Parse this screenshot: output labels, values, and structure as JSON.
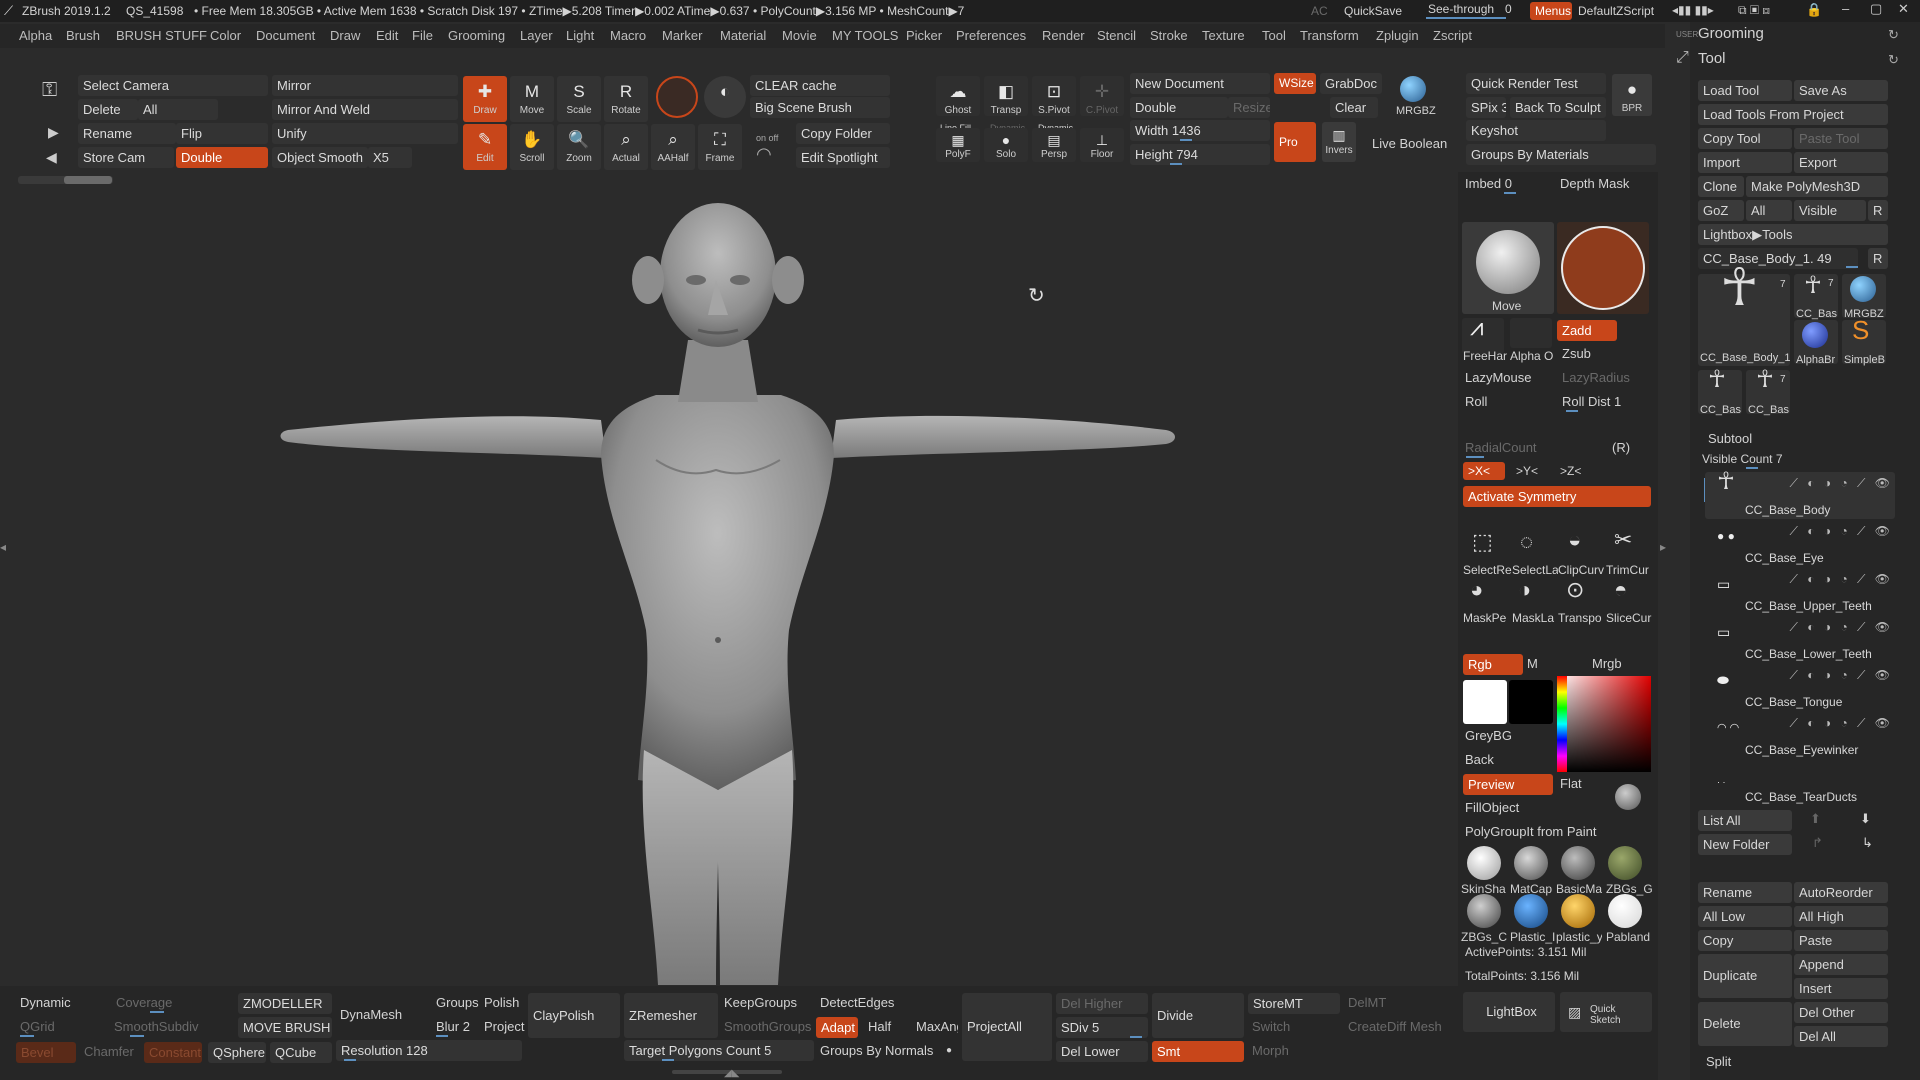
{
  "title_bar": {
    "app": "ZBrush 2019.1.2",
    "id": "QS_41598",
    "stats": "• Free Mem 18.305GB • Active Mem 1638 • Scratch Disk 197 • ZTime▶5.208 Timer▶0.002 ATime▶0.637 • PolyCount▶3.156 MP • MeshCount▶7",
    "ac": "AC",
    "quicksave": "QuickSave",
    "see_through": "See-through",
    "see_through_val": "0",
    "menus": "Menus",
    "script": "DefaultZScript"
  },
  "menu": [
    "Alpha",
    "Brush",
    "BRUSH STUFF",
    "Color",
    "Document",
    "Draw",
    "Edit",
    "File",
    "Grooming",
    "Layer",
    "Light",
    "Macro",
    "Marker",
    "Material",
    "Movie",
    "MY TOOLS",
    "Picker",
    "Preferences",
    "Render",
    "Stencil",
    "Stroke",
    "Texture",
    "Tool",
    "Transform",
    "Zplugin",
    "Zscript"
  ],
  "shelf": {
    "select_camera": "Select Camera",
    "delete": "Delete",
    "all": "All",
    "rename": "Rename",
    "store_cam": "Store Cam",
    "double": "Double",
    "mirror": "Mirror",
    "mirror_weld": "Mirror And Weld",
    "flip": "Flip",
    "unify": "Unify",
    "object_smooth": "Object Smooth",
    "x5": "X5",
    "draw": "Draw",
    "move": "Move",
    "scale": "Scale",
    "rotate": "Rotate",
    "edit": "Edit",
    "scroll": "Scroll",
    "zoom": "Zoom",
    "actual": "Actual",
    "aahalf": "AAHalf",
    "frame": "Frame",
    "clear_cache": "CLEAR cache",
    "big_scene_brush": "Big Scene Brush",
    "copy_folder": "Copy Folder",
    "edit_spotlight": "Edit Spotlight",
    "ghost": "Ghost",
    "transp": "Transp",
    "spivot": "S.Pivot",
    "cpivot": "C.Pivot",
    "polyf": "PolyF",
    "line_fill": "Line Fill",
    "solo": "Solo",
    "dynamic": "Dynamic",
    "persp": "Persp",
    "floor": "Floor",
    "new_document": "New Document",
    "wsize": "WSize",
    "grabdoc": "GrabDoc",
    "doc_double": "Double",
    "resize": "Resize",
    "clear": "Clear",
    "width": "Width 1436",
    "height": "Height 794",
    "pro": "Pro",
    "invers": "Invers",
    "live_boolean": "Live Boolean",
    "mrgbz": "MRGBZ",
    "quick_render": "Quick Render Test",
    "spix": "SPix 3",
    "back_to_sculpt": "Back To Sculpt",
    "bpr": "BPR",
    "keyshot": "Keyshot",
    "groups_by_materials": "Groups By Materials"
  },
  "brush_panel": {
    "imbed": "Imbed 0",
    "depth_mask": "Depth Mask",
    "move": "Move",
    "freehand": "FreeHar",
    "alpha_off": "Alpha O",
    "zadd": "Zadd",
    "zsub": "Zsub",
    "lazymouse": "LazyMouse",
    "lazyradius": "LazyRadius",
    "roll": "Roll",
    "roll_dist": "Roll Dist 1",
    "radialcount": "RadialCount",
    "r": "(R)",
    "sym_x": ">X<",
    "sym_y": ">Y<",
    "sym_z": ">Z<",
    "activate_symmetry": "Activate Symmetry",
    "tools": [
      "SelectRe",
      "SelectLa",
      "ClipCurv",
      "TrimCur",
      "MaskPe",
      "MaskLa",
      "Transpo",
      "SliceCur"
    ],
    "rgb": "Rgb",
    "m": "M",
    "mrgb": "Mrgb",
    "greybg": "GreyBG",
    "back": "Back",
    "preview": "Preview",
    "flat": "Flat",
    "fillobject": "FillObject",
    "polygroupit": "PolyGroupIt from Paint",
    "materials": [
      "SkinSha",
      "MatCap",
      "BasicMa",
      "ZBGs_G",
      "ZBGs_C",
      "Plastic_I",
      "plastic_y",
      "Pabland"
    ],
    "active_points": "ActivePoints: 3.151 Mil",
    "total_points": "TotalPoints: 3.156 Mil",
    "lightbox": "LightBox",
    "quick_sketch": "Quick Sketch"
  },
  "tool_panel": {
    "grooming": "Grooming",
    "tool": "Tool",
    "load_tool": "Load Tool",
    "save_as": "Save As",
    "load_from_project": "Load Tools From Project",
    "copy_tool": "Copy Tool",
    "paste_tool": "Paste Tool",
    "import": "Import",
    "export": "Export",
    "clone": "Clone",
    "make_polymesh": "Make PolyMesh3D",
    "goz": "GoZ",
    "all": "All",
    "visible": "Visible",
    "r": "R",
    "lightbox_tools": "Lightbox▶Tools",
    "current_tool": "CC_Base_Body_1. 49",
    "thumb_labels": [
      "CC_Base_Body_1",
      "CC_Bas",
      "MRGBZ",
      "AlphaBr",
      "SimpleB",
      "CC_Bas",
      "CC_Bas"
    ],
    "thumb_counts": [
      "7",
      "7",
      "7"
    ],
    "subtool": "Subtool",
    "visible_count": "Visible Count 7",
    "subtools": [
      "CC_Base_Body",
      "CC_Base_Eye",
      "CC_Base_Upper_Teeth",
      "CC_Base_Lower_Teeth",
      "CC_Base_Tongue",
      "CC_Base_Eyewinker",
      "CC_Base_TearDucts"
    ],
    "list_all": "List All",
    "new_folder": "New Folder",
    "rename": "Rename",
    "autoreorder": "AutoReorder",
    "all_low": "All Low",
    "all_high": "All High",
    "copy": "Copy",
    "paste": "Paste",
    "duplicate": "Duplicate",
    "append": "Append",
    "insert": "Insert",
    "delete": "Delete",
    "del_other": "Del Other",
    "del_all": "Del All",
    "split": "Split"
  },
  "bottom_bar": {
    "dynamic": "Dynamic",
    "coverage": "Coverage",
    "qgrid": "QGrid",
    "smoothsubdiv": "SmoothSubdiv",
    "bevel": "Bevel",
    "chamfer": "Chamfer",
    "constant": "Constant",
    "zmodeller": "ZMODELLER",
    "move_brush": "MOVE BRUSH",
    "qsphere": "QSphere",
    "qcube": "QCube",
    "dynamesh": "DynaMesh",
    "resolution": "Resolution 128",
    "groups": "Groups",
    "polish": "Polish",
    "blur": "Blur 2",
    "project": "Project",
    "claypolish": "ClayPolish",
    "zremesher": "ZRemesher",
    "keepgroups": "KeepGroups",
    "smoothgroups": "SmoothGroups",
    "target_poly": "Target Polygons Count 5",
    "detectedges": "DetectEdges",
    "adapt": "Adapt",
    "half": "Half",
    "maxang": "MaxAng",
    "groups_by_normals": "Groups By Normals",
    "projectall": "ProjectAll",
    "del_higher": "Del Higher",
    "sdiv": "SDiv 5",
    "del_lower": "Del Lower",
    "divide": "Divide",
    "smt": "Smt",
    "storemt": "StoreMT",
    "delmt": "DelMT",
    "switch": "Switch",
    "creatediff": "CreateDiff Mesh",
    "morph": "Morph"
  },
  "colors": {
    "accent": "#c8461a",
    "slider": "#5c8fbf",
    "panel": "#262626",
    "viewport": "#2b2b2b"
  }
}
